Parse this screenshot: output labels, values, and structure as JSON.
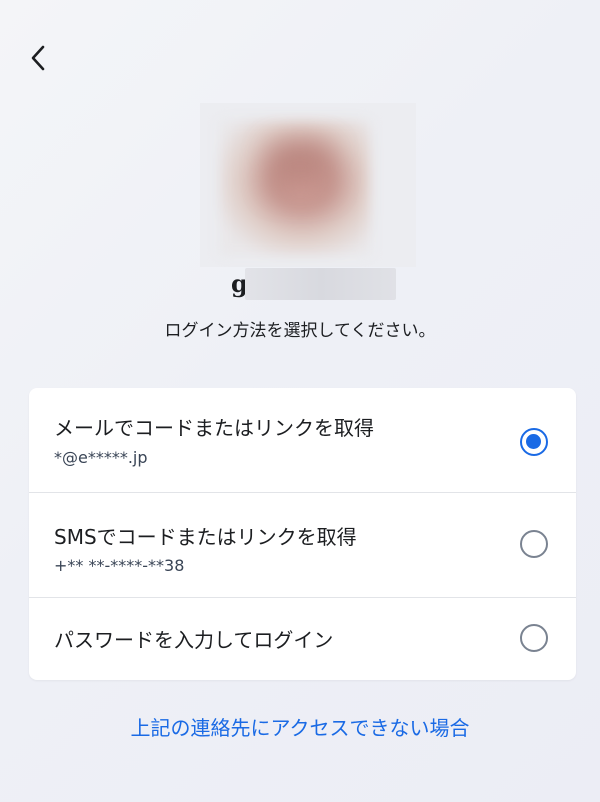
{
  "header": {
    "back_icon": "chevron-left-icon"
  },
  "profile": {
    "username_visible": "g",
    "avatar_icon": "profile-photo"
  },
  "subtitle": "ログイン方法を選択してください。",
  "options": [
    {
      "title": "メールでコードまたはリンクを取得",
      "detail": "*@e*****.jp",
      "selected": true
    },
    {
      "title": "SMSでコードまたはリンクを取得",
      "detail": "+** **-****-**38",
      "selected": false
    },
    {
      "title": "パスワードを入力してログイン",
      "detail": "",
      "selected": false
    }
  ],
  "help_link": "上記の連絡先にアクセスできない場合",
  "colors": {
    "accent": "#1a6ae5",
    "radio_unchecked": "#7a8391",
    "card_bg": "#ffffff",
    "page_bg": "#f1f2f6"
  }
}
